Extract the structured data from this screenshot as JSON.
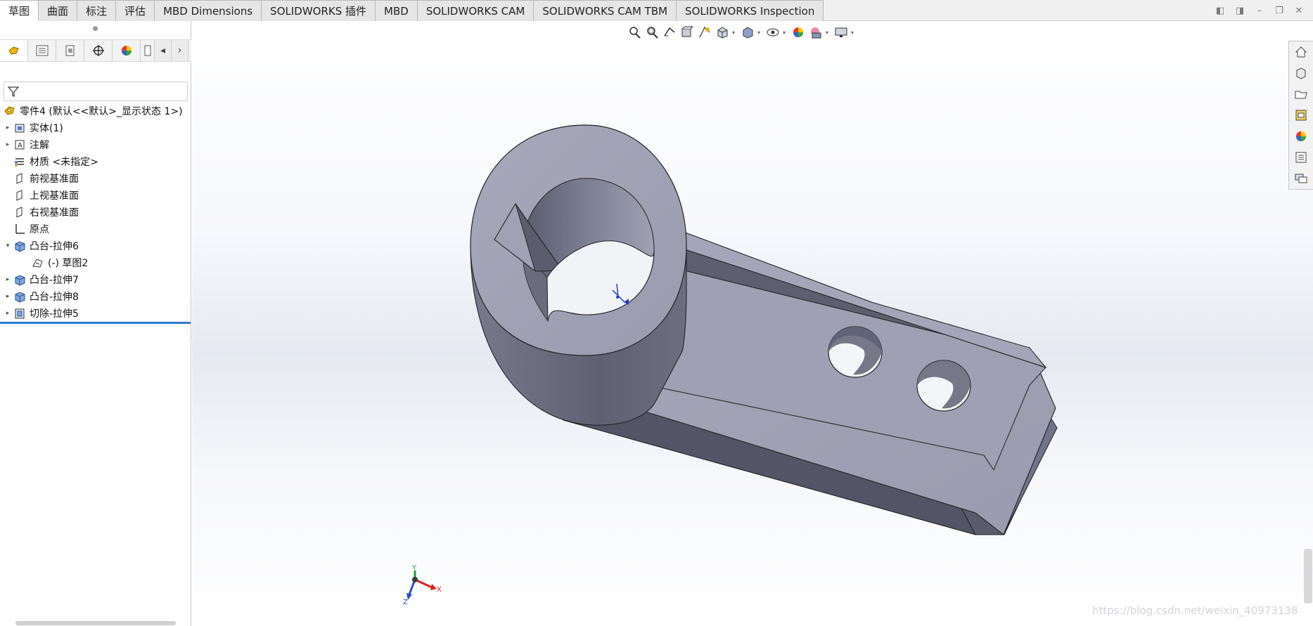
{
  "ribbon": {
    "tabs": [
      {
        "label": "草图",
        "active": true
      },
      {
        "label": "曲面",
        "active": false
      },
      {
        "label": "标注",
        "active": false
      },
      {
        "label": "评估",
        "active": false
      },
      {
        "label": "MBD Dimensions",
        "active": false
      },
      {
        "label": "SOLIDWORKS 插件",
        "active": false
      },
      {
        "label": "MBD",
        "active": false
      },
      {
        "label": "SOLIDWORKS CAM",
        "active": false
      },
      {
        "label": "SOLIDWORKS CAM TBM",
        "active": false
      },
      {
        "label": "SOLIDWORKS Inspection",
        "active": false
      }
    ]
  },
  "feature_manager": {
    "root_label": "零件4  (默认<<默认>_显示状态 1>)",
    "nodes": [
      {
        "label": "实体(1)",
        "expand": "collapsed",
        "icon": "solid-body-icon"
      },
      {
        "label": "注解",
        "expand": "collapsed",
        "icon": "annotation-icon"
      },
      {
        "label": "材质 <未指定>",
        "expand": "none",
        "icon": "material-icon"
      },
      {
        "label": "前视基准面",
        "expand": "none",
        "icon": "plane-icon"
      },
      {
        "label": "上视基准面",
        "expand": "none",
        "icon": "plane-icon"
      },
      {
        "label": "右视基准面",
        "expand": "none",
        "icon": "plane-icon"
      },
      {
        "label": "原点",
        "expand": "none",
        "icon": "origin-icon"
      },
      {
        "label": "凸台-拉伸6",
        "expand": "expanded",
        "icon": "boss-extrude-icon"
      },
      {
        "label": "(-) 草图2",
        "expand": "none",
        "icon": "sketch-icon"
      },
      {
        "label": "凸台-拉伸7",
        "expand": "collapsed",
        "icon": "boss-extrude-icon"
      },
      {
        "label": "凸台-拉伸8",
        "expand": "collapsed",
        "icon": "boss-extrude-icon"
      },
      {
        "label": "切除-拉伸5",
        "expand": "collapsed",
        "icon": "cut-extrude-icon"
      }
    ]
  },
  "viewport": {
    "triad_x": "X",
    "triad_y": "Y",
    "triad_z": "Z",
    "watermark": "https://blog.csdn.net/weixin_40973138"
  },
  "colors": {
    "model_face_top": "#a2a3b5",
    "model_face_side": "#6a6c7e",
    "model_face_dark": "#565868",
    "selection_blue": "#2a7ad2"
  }
}
